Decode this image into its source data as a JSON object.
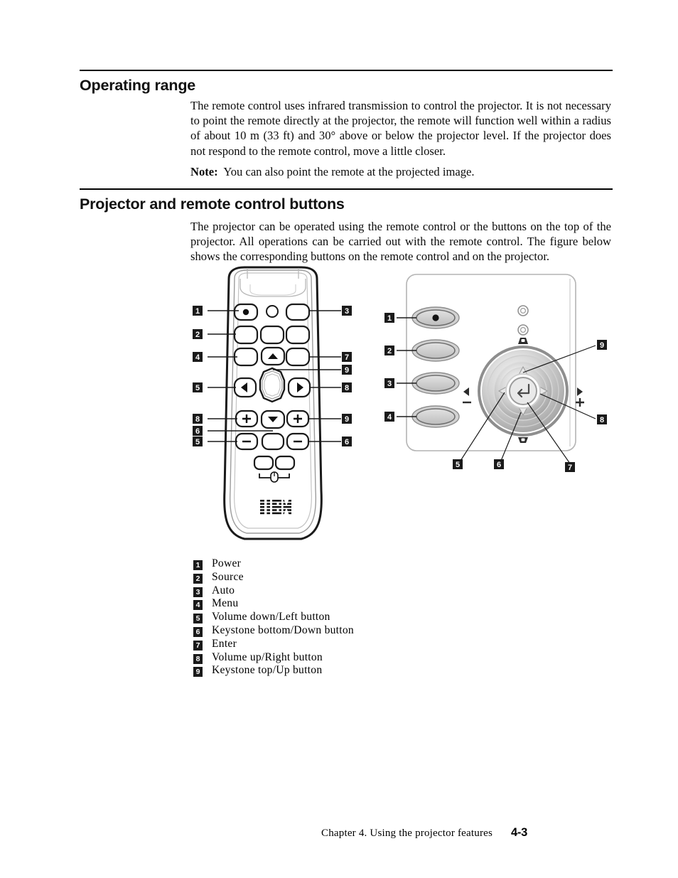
{
  "document": {
    "sections": [
      {
        "id": "operating-range",
        "heading": "Operating range",
        "paragraph": "The remote control uses infrared transmission to control the projector. It is not necessary to point the remote directly at the projector, the remote will function well within a radius of about 10 m (33 ft) and 30° above or below the projector level. If the projector does not respond to the remote control, move a little closer.",
        "note_label": "Note:",
        "note_text": "You can also point the remote at the projected image."
      },
      {
        "id": "projector-and-remote-control-buttons",
        "heading": "Projector and remote control buttons",
        "paragraph": "The projector can be operated using the remote control or the buttons on the top of the projector. All operations can be carried out with the remote control. The figure below shows the corresponding buttons on the remote control and on the projector."
      }
    ]
  },
  "figure": {
    "remote": {
      "brand": "IBM",
      "callouts_left": [
        "1",
        "2",
        "4",
        "5",
        "8",
        "6",
        "5"
      ],
      "callouts_right": [
        "3",
        "7",
        "9",
        "8",
        "9",
        "6"
      ],
      "button_glyphs": [
        "▲",
        "▼",
        "◀",
        "▶",
        "+",
        "−"
      ]
    },
    "projector": {
      "callouts_left": [
        "1",
        "2",
        "3",
        "4"
      ],
      "callouts_right": [
        "9",
        "8"
      ],
      "callouts_bottom": [
        "5",
        "6",
        "7"
      ],
      "dial_markers": {
        "left": "−",
        "right": "+"
      },
      "enter_glyph": "↵"
    }
  },
  "legend": {
    "items": [
      {
        "number": "1",
        "label": "Power"
      },
      {
        "number": "2",
        "label": "Source"
      },
      {
        "number": "3",
        "label": "Auto"
      },
      {
        "number": "4",
        "label": "Menu"
      },
      {
        "number": "5",
        "label": "Volume down/Left button"
      },
      {
        "number": "6",
        "label": "Keystone bottom/Down button"
      },
      {
        "number": "7",
        "label": "Enter"
      },
      {
        "number": "8",
        "label": "Volume up/Right button"
      },
      {
        "number": "9",
        "label": "Keystone top/Up button"
      }
    ]
  },
  "footer": {
    "chapter": "Chapter 4. Using the projector features",
    "page": "4-3"
  },
  "colors": {
    "text": "#000000",
    "badge_bg": "#1a1a1a",
    "rule": "#000000",
    "device_outline": "#1a1a1a",
    "device_fill_light": "#f2f2f2",
    "device_fill_mid": "#c9c9c9",
    "device_fill_dark": "#8e8e8e"
  }
}
